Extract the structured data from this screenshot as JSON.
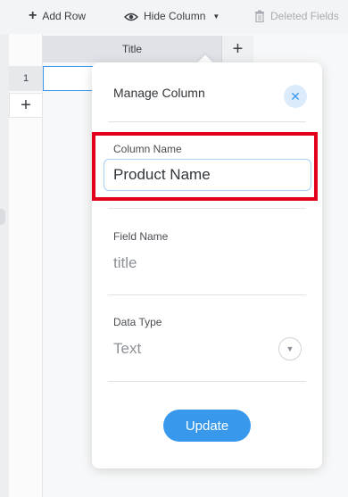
{
  "toolbar": {
    "add_row": "Add Row",
    "hide_column": "Hide Column",
    "deleted_fields": "Deleted Fields"
  },
  "grid": {
    "header_title": "Title",
    "add_column_icon": "plus-icon",
    "row_number": "1",
    "add_row_icon": "plus-icon"
  },
  "popover": {
    "title": "Manage Column",
    "close_icon": "close-icon",
    "column_name": {
      "label": "Column Name",
      "value": "Product Name"
    },
    "field_name": {
      "label": "Field Name",
      "value": "title"
    },
    "data_type": {
      "label": "Data Type",
      "value": "Text",
      "dropdown_icon": "chevron-down-icon"
    },
    "update_button": "Update"
  },
  "colors": {
    "accent": "#3899ec",
    "highlight": "#e3001b"
  }
}
